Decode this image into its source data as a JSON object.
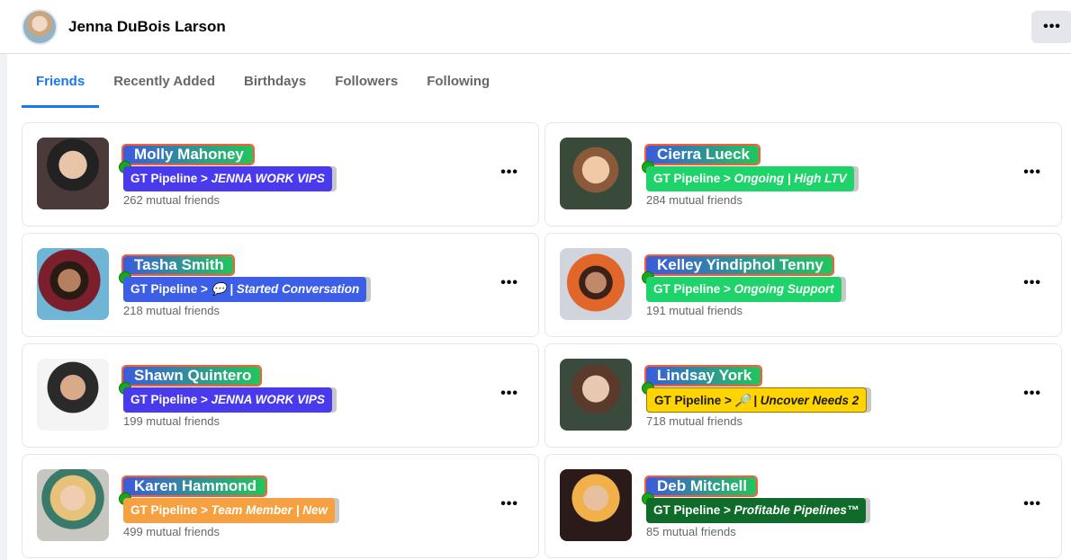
{
  "header": {
    "profile_name": "Jenna DuBois Larson",
    "more_icon": "more-horizontal-icon"
  },
  "tabs": [
    {
      "label": "Friends",
      "active": true
    },
    {
      "label": "Recently Added",
      "active": false
    },
    {
      "label": "Birthdays",
      "active": false
    },
    {
      "label": "Followers",
      "active": false
    },
    {
      "label": "Following",
      "active": false
    }
  ],
  "friends": [
    {
      "name": "Molly Mahoney",
      "pipeline_prefix": "GT Pipeline > ",
      "pipeline_stage": "JENNA WORK VIPS",
      "tag_color": "#4a3aed",
      "mutual": "262 mutual friends"
    },
    {
      "name": "Cierra Lueck",
      "pipeline_prefix": "GT Pipeline > ",
      "pipeline_stage": "Ongoing | High LTV",
      "tag_color": "#1fd36b",
      "mutual": "284 mutual friends"
    },
    {
      "name": "Tasha Smith",
      "pipeline_prefix": "GT Pipeline > ",
      "pipeline_stage": "💬 | Started Conversation",
      "tag_color": "#3d5ee6",
      "mutual": "218 mutual friends"
    },
    {
      "name": "Kelley Yindiphol Tenny",
      "pipeline_prefix": "GT Pipeline > ",
      "pipeline_stage": "Ongoing Support",
      "tag_color": "#1fd36b",
      "mutual": "191 mutual friends"
    },
    {
      "name": "Shawn Quintero",
      "pipeline_prefix": "GT Pipeline > ",
      "pipeline_stage": "JENNA WORK VIPS",
      "tag_color": "#4a3aed",
      "mutual": "199 mutual friends"
    },
    {
      "name": "Lindsay York",
      "pipeline_prefix": "GT Pipeline > ",
      "pipeline_stage": "🔎 | Uncover Needs 2",
      "tag_color": "#ffd400",
      "mutual": "718 mutual friends"
    },
    {
      "name": "Karen Hammond",
      "pipeline_prefix": "GT Pipeline > ",
      "pipeline_stage": "Team Member | New",
      "tag_color": "#f5a142",
      "mutual": "499 mutual friends"
    },
    {
      "name": "Deb Mitchell",
      "pipeline_prefix": "GT Pipeline > ",
      "pipeline_stage": "Profitable Pipelines™",
      "tag_color": "#0f6b2a",
      "mutual": "85 mutual friends"
    }
  ]
}
